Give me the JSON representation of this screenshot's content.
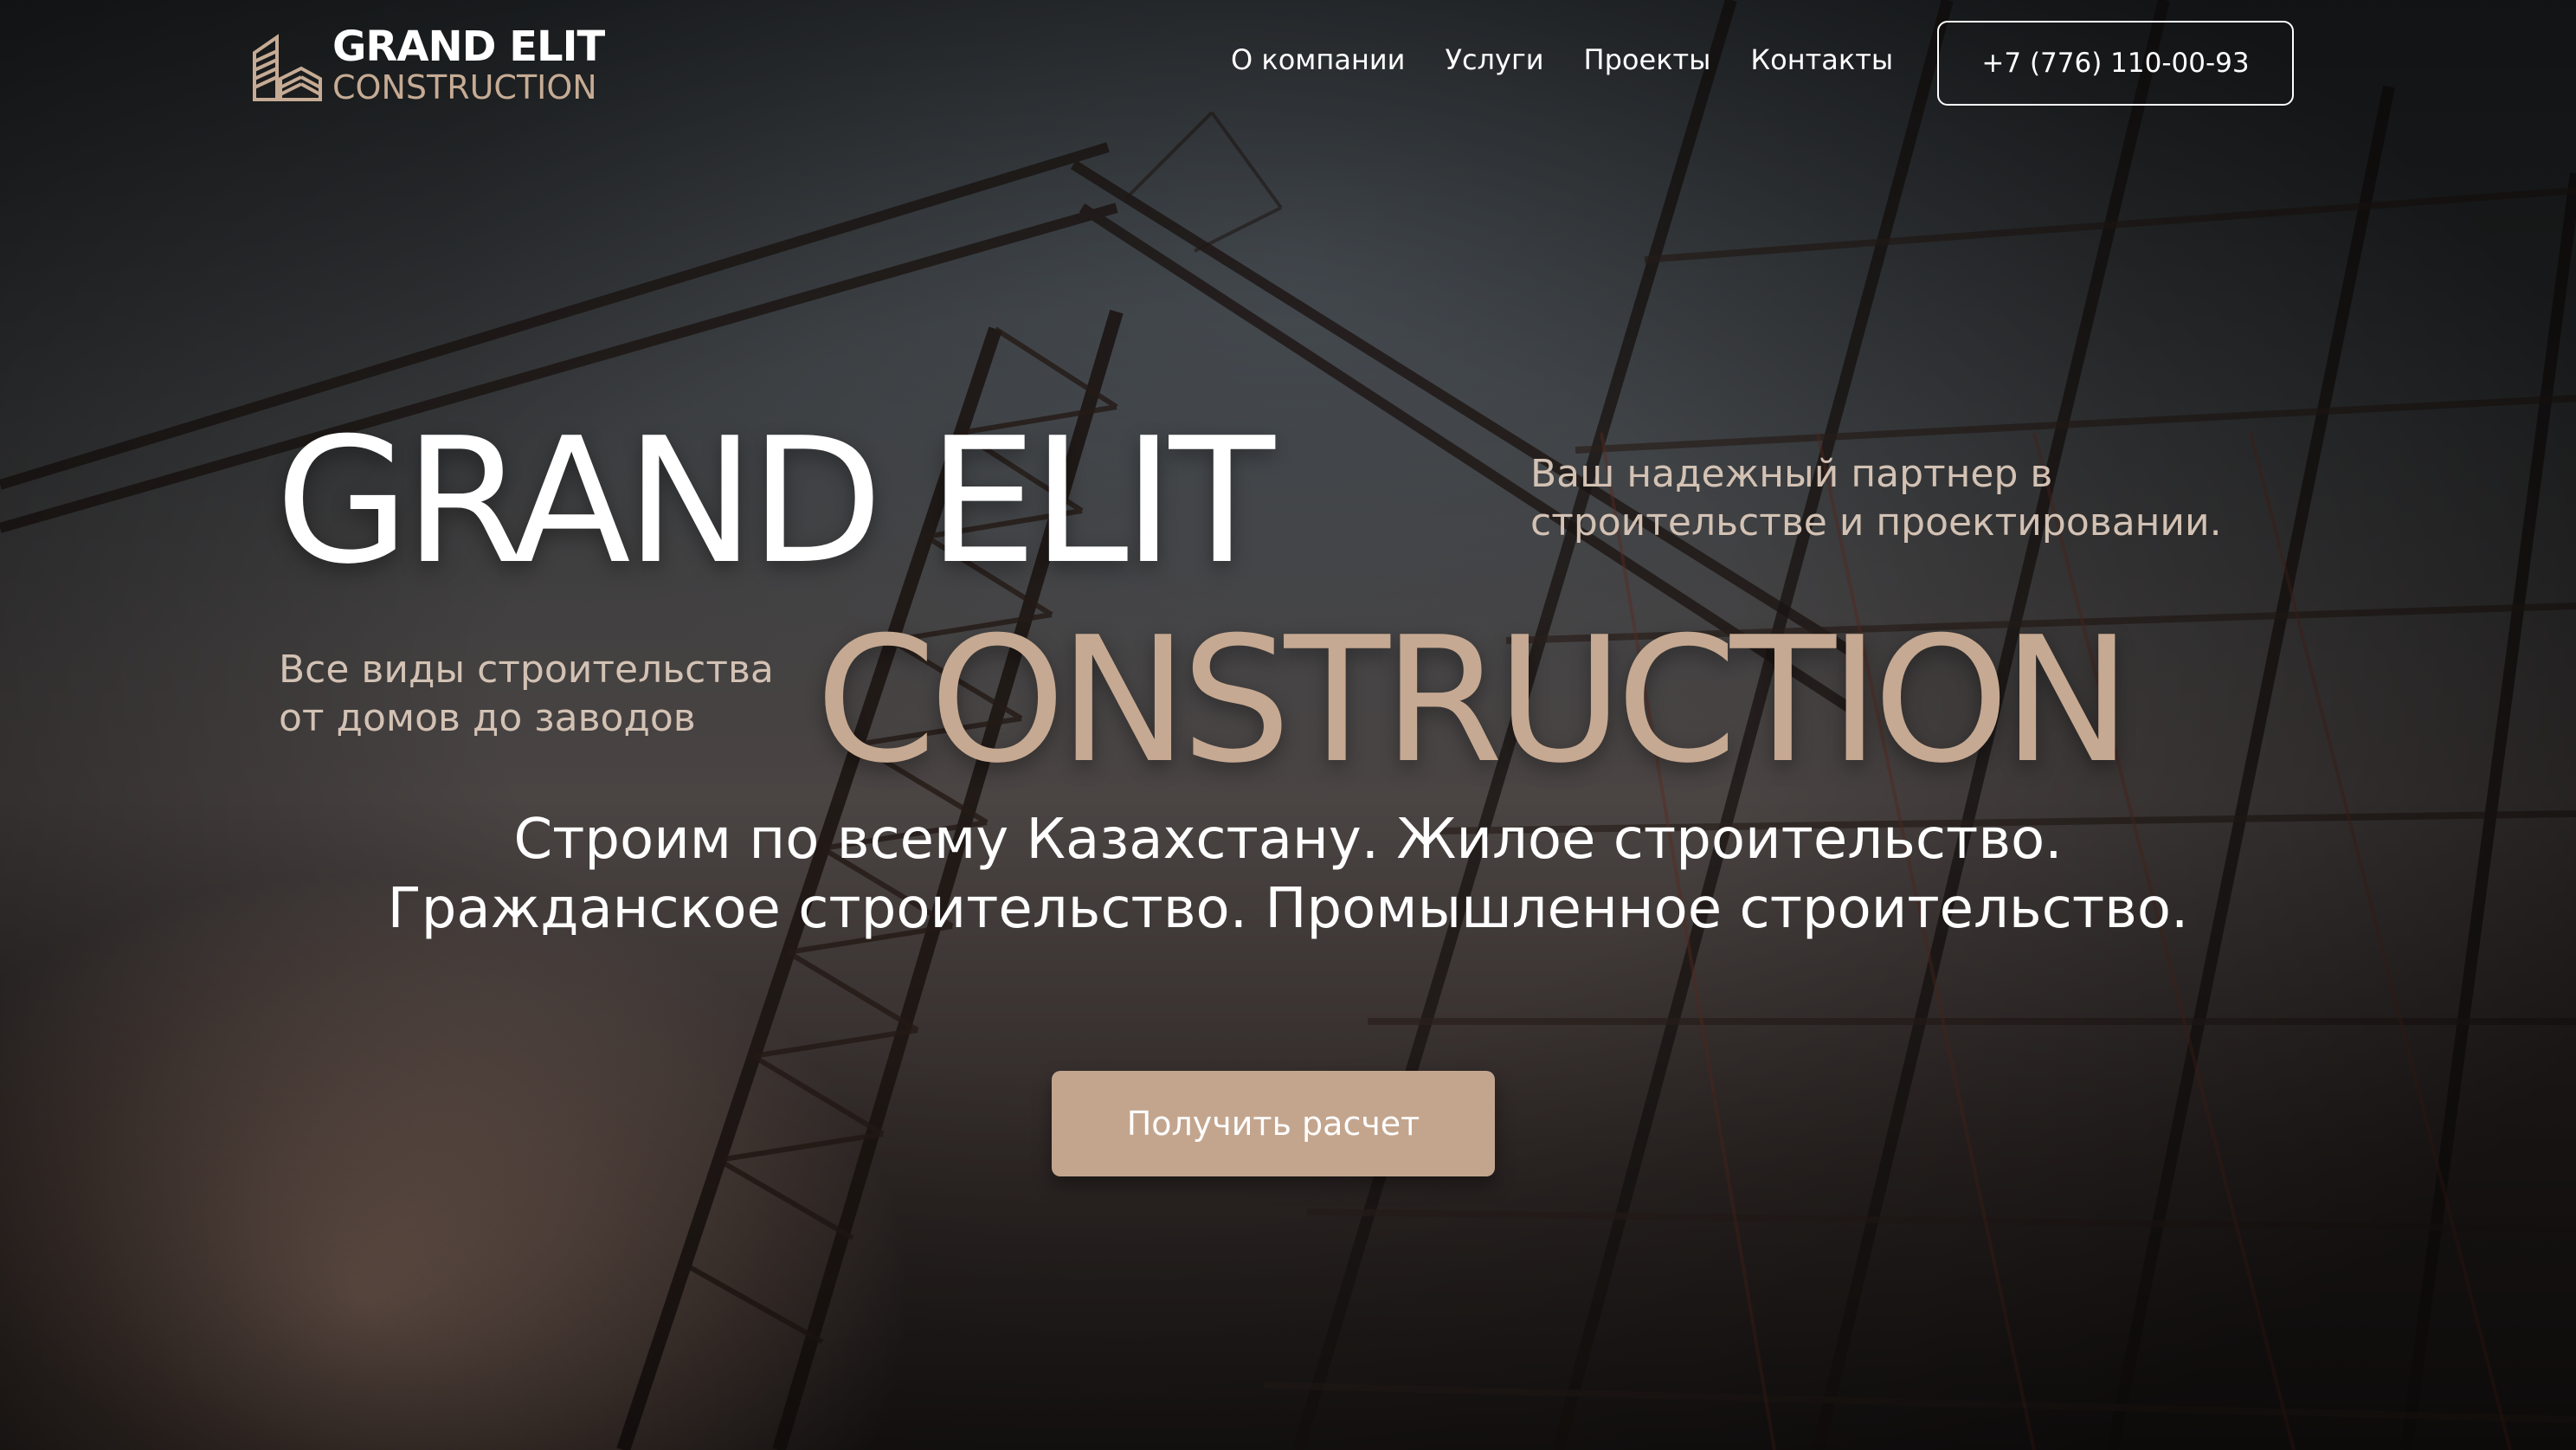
{
  "colors": {
    "accent": "#c6a992",
    "button_bg": "#c3a58e",
    "text_white": "#ffffff",
    "tagline": "#d3c2b4"
  },
  "header": {
    "logo_line1": "GRAND ELIT",
    "logo_line2": "CONSTRUCTION",
    "logo_icon": "building-stack-icon",
    "nav": [
      {
        "label": "О компании"
      },
      {
        "label": "Услуги"
      },
      {
        "label": "Проекты"
      },
      {
        "label": "Контакты"
      }
    ],
    "phone": "+7 (776) 110-00-93"
  },
  "hero": {
    "title_line1": "GRAND ELIT",
    "title_line2": "CONSTRUCTION",
    "tagline_right_1": "Ваш надежный партнер в",
    "tagline_right_2": "строительстве и проектировании.",
    "tagline_left_1": "Все виды строительства",
    "tagline_left_2": "от домов до заводов",
    "subtitle_line1": "Строим по всему Казахстану. Жилое строительство.",
    "subtitle_line2": "Гражданское строительство. Промышленное строительство.",
    "cta_label": "Получить расчет"
  }
}
